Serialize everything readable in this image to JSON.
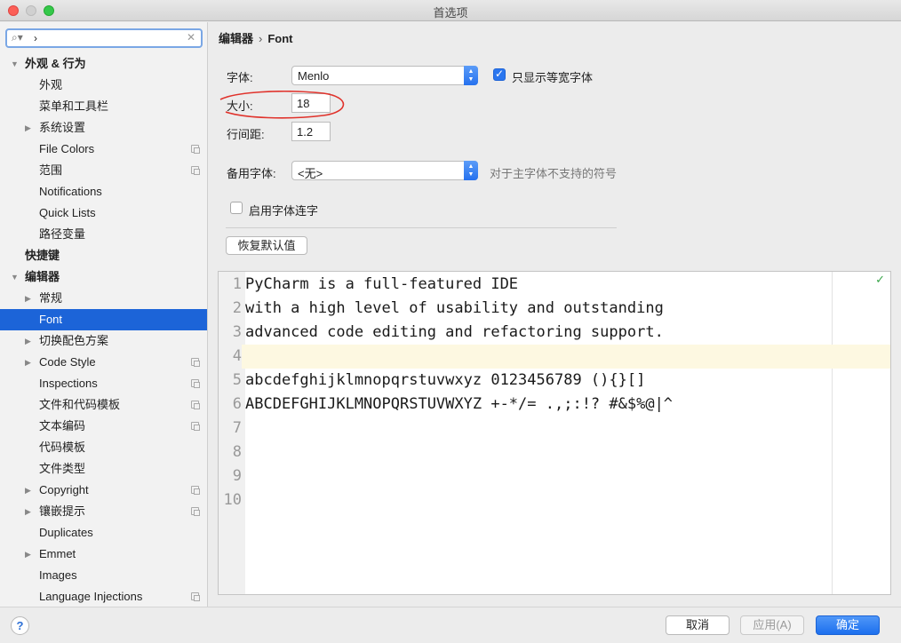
{
  "window": {
    "title": "首选项"
  },
  "search": {
    "value": "›"
  },
  "sidebar": {
    "items": [
      {
        "label": "外观 & 行为",
        "level": 0,
        "arrow": "▼",
        "bold": true
      },
      {
        "label": "外观",
        "level": 1
      },
      {
        "label": "菜单和工具栏",
        "level": 1
      },
      {
        "label": "系统设置",
        "level": 1,
        "arrow": "▶"
      },
      {
        "label": "File Colors",
        "level": 1,
        "copy": true
      },
      {
        "label": "范围",
        "level": 1,
        "copy": true
      },
      {
        "label": "Notifications",
        "level": 1
      },
      {
        "label": "Quick Lists",
        "level": 1
      },
      {
        "label": "路径变量",
        "level": 1
      },
      {
        "label": "快捷键",
        "level": 0,
        "bold": true
      },
      {
        "label": "编辑器",
        "level": 0,
        "arrow": "▼",
        "bold": true
      },
      {
        "label": "常规",
        "level": 1,
        "arrow": "▶"
      },
      {
        "label": "Font",
        "level": 1,
        "selected": true
      },
      {
        "label": "切换配色方案",
        "level": 1,
        "arrow": "▶"
      },
      {
        "label": "Code Style",
        "level": 1,
        "arrow": "▶",
        "copy": true
      },
      {
        "label": "Inspections",
        "level": 1,
        "copy": true
      },
      {
        "label": "文件和代码模板",
        "level": 1,
        "copy": true
      },
      {
        "label": "文本编码",
        "level": 1,
        "copy": true
      },
      {
        "label": "代码模板",
        "level": 1
      },
      {
        "label": "文件类型",
        "level": 1
      },
      {
        "label": "Copyright",
        "level": 1,
        "arrow": "▶",
        "copy": true
      },
      {
        "label": "镶嵌提示",
        "level": 1,
        "arrow": "▶",
        "copy": true
      },
      {
        "label": "Duplicates",
        "level": 1
      },
      {
        "label": "Emmet",
        "level": 1,
        "arrow": "▶"
      },
      {
        "label": "Images",
        "level": 1
      },
      {
        "label": "Language Injections",
        "level": 1,
        "copy": true
      }
    ]
  },
  "breadcrumb": {
    "parent": "编辑器",
    "separator": "›",
    "current": "Font"
  },
  "font_settings": {
    "font_label": "字体:",
    "font_value": "Menlo",
    "monospace_only_label": "只显示等宽字体",
    "monospace_only_checked": true,
    "size_label": "大小:",
    "size_value": "18",
    "line_spacing_label": "行间距:",
    "line_spacing_value": "1.2",
    "fallback_label": "备用字体:",
    "fallback_value": "<无>",
    "fallback_hint": "对于主字体不支持的符号",
    "ligatures_label": "启用字体连字",
    "ligatures_checked": false,
    "restore_defaults_label": "恢复默认值"
  },
  "preview": {
    "lines": [
      {
        "num": "1",
        "text": "PyCharm is a full-featured IDE"
      },
      {
        "num": "2",
        "text": "with a high level of usability and outstanding"
      },
      {
        "num": "3",
        "text": "advanced code editing and refactoring support."
      },
      {
        "num": "4",
        "text": "",
        "current": true
      },
      {
        "num": "5",
        "text": "abcdefghijklmnopqrstuvwxyz 0123456789 (){}[]"
      },
      {
        "num": "6",
        "text": "ABCDEFGHIJKLMNOPQRSTUVWXYZ +-*/= .,;:!? #&$%@|^"
      },
      {
        "num": "7",
        "text": ""
      },
      {
        "num": "8",
        "text": ""
      },
      {
        "num": "9",
        "text": ""
      },
      {
        "num": "10",
        "text": ""
      }
    ],
    "status_icon": "inspection-ok-icon"
  },
  "footer": {
    "help_label": "?",
    "cancel_label": "取消",
    "apply_label": "应用(A)",
    "ok_label": "确定"
  },
  "colors": {
    "accent": "#1c64d8",
    "annotation": "#e0322b",
    "current_line": "#fdf8e1"
  }
}
